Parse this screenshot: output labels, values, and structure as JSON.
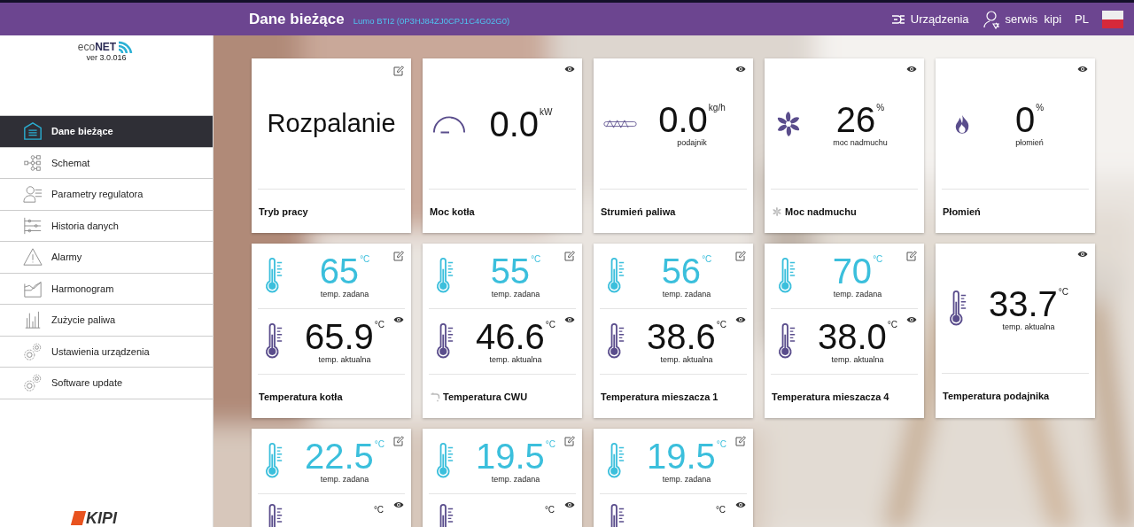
{
  "header": {
    "title": "Dane bieżące",
    "subtitle": "Lumo BTI2 (0P3HJ84ZJ0CPJ1C4G02G0)",
    "devices": "Urządzenia",
    "user": "serwis  kipi",
    "language": "PL"
  },
  "sidebar": {
    "logo_prefix": "eco",
    "logo_main": "NET",
    "version": "ver 3.0.016",
    "footer_logo": "KIPI",
    "items": [
      {
        "label": "Dane bieżące",
        "selected": true
      },
      {
        "label": "Schemat",
        "selected": false
      },
      {
        "label": "Parametry regulatora",
        "selected": false
      },
      {
        "label": "Historia danych",
        "selected": false
      },
      {
        "label": "Alarmy",
        "selected": false
      },
      {
        "label": "Harmonogram",
        "selected": false
      },
      {
        "label": "Zużycie paliwa",
        "selected": false
      },
      {
        "label": "Ustawienia urządzenia",
        "selected": false
      },
      {
        "label": "Software update",
        "selected": false
      }
    ]
  },
  "cards": [
    {
      "kind": "status",
      "text": "Rozpalanie",
      "title": "Tryb pracy"
    },
    {
      "kind": "value",
      "value": "0.0",
      "unit": "kW",
      "title": "Moc kotła"
    },
    {
      "kind": "value",
      "value": "0.0",
      "unit": "kg/h",
      "caption": "podajnik",
      "title": "Strumień paliwa"
    },
    {
      "kind": "value",
      "value": "26",
      "unit": "%",
      "caption": "moc nadmuchu",
      "title": "Moc nadmuchu"
    },
    {
      "kind": "value",
      "value": "0",
      "unit": "%",
      "caption": "płomień",
      "title": "Płomień"
    },
    {
      "kind": "temp",
      "set": {
        "value": "65",
        "unit": "°C",
        "caption": "temp. zadana"
      },
      "actual": {
        "value": "65.9",
        "unit": "°C",
        "caption": "temp. aktualna"
      },
      "title": "Temperatura kotła"
    },
    {
      "kind": "temp",
      "set": {
        "value": "55",
        "unit": "°C",
        "caption": "temp. zadana"
      },
      "actual": {
        "value": "46.6",
        "unit": "°C",
        "caption": "temp. aktualna"
      },
      "title": "Temperatura CWU"
    },
    {
      "kind": "temp",
      "set": {
        "value": "56",
        "unit": "°C",
        "caption": "temp. zadana"
      },
      "actual": {
        "value": "38.6",
        "unit": "°C",
        "caption": "temp. aktualna"
      },
      "title": "Temperatura mieszacza 1"
    },
    {
      "kind": "temp",
      "set": {
        "value": "70",
        "unit": "°C",
        "caption": "temp. zadana"
      },
      "actual": {
        "value": "38.0",
        "unit": "°C",
        "caption": "temp. aktualna"
      },
      "title": "Temperatura mieszacza 4"
    },
    {
      "kind": "single-temp",
      "actual": {
        "value": "33.7",
        "unit": "°C",
        "caption": "temp. aktualna"
      },
      "title": "Temperatura podajnika"
    },
    {
      "kind": "temp",
      "set": {
        "value": "22.5",
        "unit": "°C",
        "caption": "temp. zadana"
      },
      "actual": {
        "unit": "°C"
      }
    },
    {
      "kind": "temp",
      "set": {
        "value": "19.5",
        "unit": "°C",
        "caption": "temp. zadana"
      },
      "actual": {
        "unit": "°C"
      }
    },
    {
      "kind": "temp",
      "set": {
        "value": "19.5",
        "unit": "°C",
        "caption": "temp. zadana"
      },
      "actual": {
        "unit": "°C"
      }
    }
  ]
}
